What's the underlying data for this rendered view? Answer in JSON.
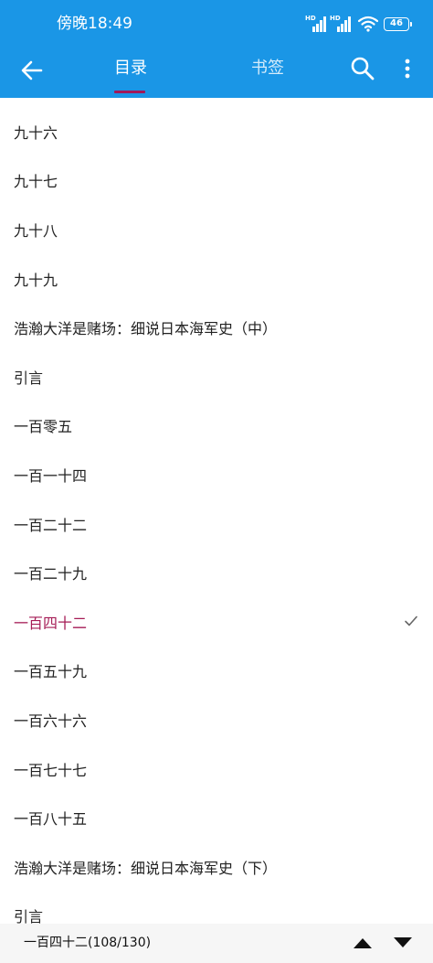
{
  "status_bar": {
    "time": "傍晚18:49",
    "signal_1_label": "HD",
    "signal_2_label": "HD",
    "battery_level": "46"
  },
  "toolbar": {
    "tabs": [
      {
        "label": "目录",
        "active": true
      },
      {
        "label": "书签",
        "active": false
      }
    ],
    "icons": [
      "back-arrow-icon",
      "search-icon",
      "more-vertical-icon"
    ]
  },
  "chapters": [
    {
      "title": "九十六"
    },
    {
      "title": "九十七"
    },
    {
      "title": "九十八"
    },
    {
      "title": "九十九"
    },
    {
      "title": "浩瀚大洋是赌场：细说日本海军史（中）"
    },
    {
      "title": "引言"
    },
    {
      "title": "一百零五"
    },
    {
      "title": "一百一十四"
    },
    {
      "title": "一百二十二"
    },
    {
      "title": "一百二十九"
    },
    {
      "title": "一百四十二",
      "current": true
    },
    {
      "title": "一百五十九"
    },
    {
      "title": "一百六十六"
    },
    {
      "title": "一百七十七"
    },
    {
      "title": "一百八十五"
    },
    {
      "title": "浩瀚大洋是赌场：细说日本海军史（下）"
    },
    {
      "title": "引言"
    }
  ],
  "bottom_bar": {
    "progress_text": "一百四十二(108/130)"
  },
  "colors": {
    "header_bg": "#1a96e6",
    "accent": "#a51b55",
    "text": "#222222",
    "bottom_bg": "#f6f6f6"
  }
}
